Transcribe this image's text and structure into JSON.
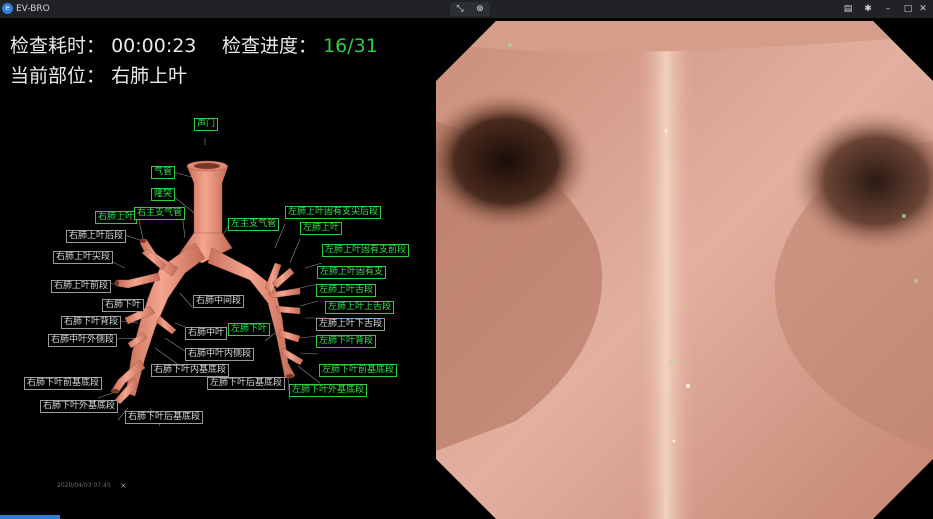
{
  "app": {
    "title": "EV-BRO"
  },
  "titlebar_icons": [
    "shrink-icon",
    "close-icon",
    "document-icon",
    "settings-icon",
    "minimize-icon",
    "maximize-icon",
    "window-close-icon"
  ],
  "info": {
    "time_label": "检查耗时：",
    "time_value": "00:00:23",
    "progress_label": "检查进度：",
    "progress_value": "16/31",
    "location_label": "当前部位：",
    "location_value": "右肺上叶"
  },
  "colors": {
    "accent_green": "#2ecc40",
    "airway": "#e8927c",
    "video_tint": "#d9a38f"
  },
  "labels": [
    {
      "text": "声门",
      "done": true
    },
    {
      "text": "气管",
      "done": true
    },
    {
      "text": "隆突",
      "done": true
    },
    {
      "text": "右肺上叶",
      "done": true
    },
    {
      "text": "右主支气管",
      "done": true
    },
    {
      "text": "左主支气管",
      "done": true
    },
    {
      "text": "右肺上叶后段",
      "done": false
    },
    {
      "text": "右肺上叶尖段",
      "done": false
    },
    {
      "text": "右肺上叶前段",
      "done": false
    },
    {
      "text": "右肺下叶",
      "done": false
    },
    {
      "text": "右肺下叶背段",
      "done": false
    },
    {
      "text": "右肺中叶外侧段",
      "done": false
    },
    {
      "text": "右肺中间段",
      "done": false
    },
    {
      "text": "右肺中叶",
      "done": false
    },
    {
      "text": "右肺中叶内侧段",
      "done": false
    },
    {
      "text": "右肺下叶内基底段",
      "done": false
    },
    {
      "text": "右肺下叶前基底段",
      "done": false
    },
    {
      "text": "右肺下叶外基底段",
      "done": false
    },
    {
      "text": "右肺下叶后基底段",
      "done": false
    },
    {
      "text": "左肺上叶固有支尖后段",
      "done": true
    },
    {
      "text": "左肺上叶",
      "done": true
    },
    {
      "text": "左肺上叶固有支前段",
      "done": true
    },
    {
      "text": "左肺上叶固有支",
      "done": true
    },
    {
      "text": "左肺上叶舌段",
      "done": true
    },
    {
      "text": "左肺上叶上舌段",
      "done": true
    },
    {
      "text": "左肺下叶",
      "done": true
    },
    {
      "text": "左肺上叶下舌段",
      "done": false
    },
    {
      "text": "左肺下叶背段",
      "done": true
    },
    {
      "text": "左肺下叶前基底段",
      "done": true
    },
    {
      "text": "左肺下叶后基底段",
      "done": false
    },
    {
      "text": "左肺下叶外基底段",
      "done": true
    }
  ],
  "status": {
    "timestamp": "2020/04/03 07:45"
  }
}
